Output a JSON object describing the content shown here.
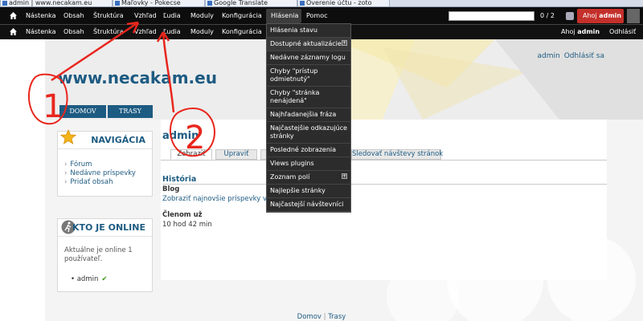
{
  "browser_tabs": [
    {
      "label": "admin | www.necakam.eu"
    },
    {
      "label": "Maľovky - Pokecse"
    },
    {
      "label": "Google Translate"
    },
    {
      "label": "Overenie účtu - zoto"
    }
  ],
  "toolbar_primary": {
    "home_icon": "home-icon",
    "items": [
      "Nástenka",
      "Obsah",
      "Štruktúra",
      "Vzhľad",
      "Ľudia",
      "Moduly",
      "Konfigurácia",
      "Hlásenia",
      "Pomoc"
    ],
    "active_item": "Hlásenia",
    "counter": "0 / 2",
    "user_greeting": "Ahoj",
    "user_name": "admin"
  },
  "toolbar_secondary": {
    "items": [
      "Nástenka",
      "Obsah",
      "Štruktúra",
      "Vzhľad",
      "Ľudia",
      "Moduly",
      "Konfigurácia"
    ],
    "greeting": "Ahoj",
    "user_name": "admin",
    "logout": "Odhlásiť"
  },
  "header": {
    "site_name": "www.necakam.eu",
    "user_link": "admin",
    "logout_link": "Odhlásiť sa",
    "nav": [
      "DOMOV",
      "TRASY"
    ]
  },
  "sidebar": {
    "navigation": {
      "title": "NAVIGÁCIA",
      "icon": "star-icon",
      "items": [
        "Fórum",
        "Nedávne príspevky",
        "Pridať obsah"
      ]
    },
    "online": {
      "title": "KTO JE ONLINE",
      "icon": "runner-icon",
      "text": "Aktuálne je online 1 používateľ.",
      "user": "admin"
    }
  },
  "main": {
    "title": "admin",
    "tabs": [
      "Zobraziť",
      "Upraviť",
      "",
      "",
      "Sledovať návštevy stránok"
    ],
    "active_tab": "Zobraziť",
    "history_title": "História",
    "blog_label": "Blog",
    "blog_link": "Zobraziť najnovšie príspevky v blogu",
    "member_label": "Členom už",
    "member_value": "10 hod 42 min"
  },
  "dropdown": {
    "items": [
      {
        "label": "Hlásenia stavu",
        "has_plus": false
      },
      {
        "label": "Dostupné aktualizácie",
        "has_plus": true
      },
      {
        "label": "Nedávne záznamy logu",
        "has_plus": false
      },
      {
        "label": "Chyby \"prístup odmietnutý\"",
        "has_plus": false
      },
      {
        "label": "Chyby \"stránka nenájdená\"",
        "has_plus": false
      },
      {
        "label": "Najhľadanejšia fráza",
        "has_plus": false
      },
      {
        "label": "Najčastejšie odkazujúce stránky",
        "has_plus": false
      },
      {
        "label": "Posledné zobrazenia",
        "has_plus": false
      },
      {
        "label": "Views plugins",
        "has_plus": false
      },
      {
        "label": "Zoznam polí",
        "has_plus": true
      },
      {
        "label": "Najlepšie stránky",
        "has_plus": false
      },
      {
        "label": "Najčastejší návštevníci",
        "has_plus": false
      }
    ]
  },
  "footer": {
    "links": [
      "Domov",
      "Trasy"
    ],
    "separator": "|"
  },
  "annotations": {
    "marker_1": "1",
    "marker_2": "2",
    "color": "#e8261c"
  },
  "colors": {
    "toolbar": "#0d0d0d",
    "accent_blue": "#1d5b82",
    "user_red": "#c4302b"
  }
}
